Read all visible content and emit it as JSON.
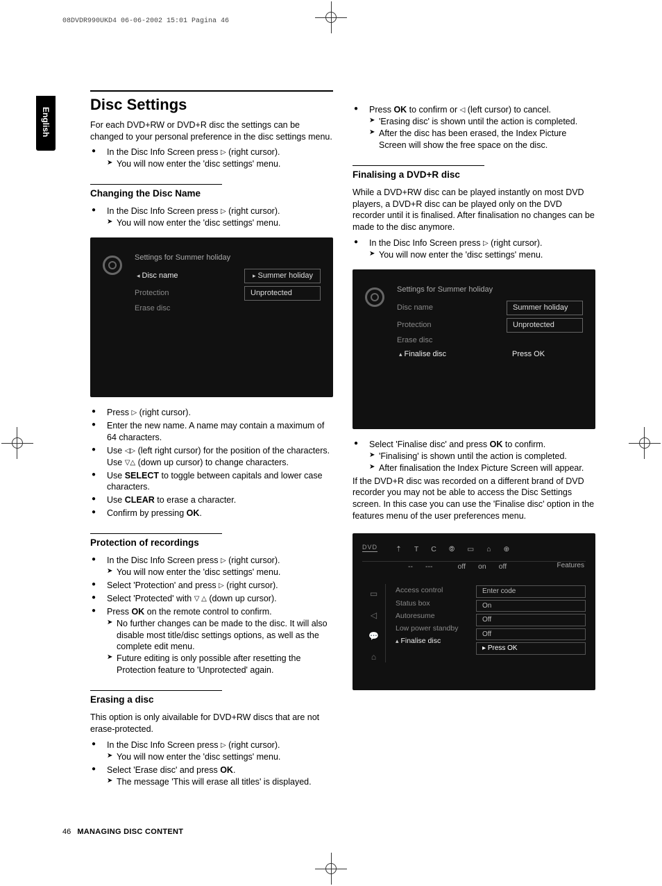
{
  "prepress": {
    "jobline": "08DVDR990UKD4  06-06-2002  15:01  Pagina 46"
  },
  "langtab": "English",
  "footer": {
    "page": "46",
    "chapter": "MANAGING DISC CONTENT"
  },
  "left": {
    "heading": "Disc Settings",
    "intro": "For each DVD+RW or DVD+R disc the settings can be changed to your personal preference in the disc settings menu.",
    "intro_b1_a": "In the Disc Info Screen press ",
    "intro_b1_b": " (right cursor).",
    "intro_b1_sub": "You will now enter the 'disc settings' menu.",
    "sub1": "Changing the Disc Name",
    "sub1_b1_a": "In the Disc Info Screen press ",
    "sub1_b1_b": " (right cursor).",
    "sub1_b1_sub": "You will now enter the 'disc settings' menu.",
    "osd1": {
      "title": "Settings for Summer holiday",
      "r1_label": "Disc name",
      "r1_value": "Summer holiday",
      "r2_label": "Protection",
      "r2_value": "Unprotected",
      "r3_label": "Erase disc"
    },
    "sub1_b2_a": "Press ",
    "sub1_b2_b": "  (right cursor).",
    "sub1_b3": "Enter the new name.  A name may contain a maximum of 64 characters.",
    "sub1_b4_a": "Use ",
    "sub1_b4_b": " (left right cursor) for the position of the characters. Use ",
    "sub1_b4_c": " (down up cursor) to change characters.",
    "sub1_b5_a": "Use ",
    "sub1_b5_bold": "SELECT",
    "sub1_b5_b": " to toggle between capitals and lower case characters.",
    "sub1_b6_a": "Use ",
    "sub1_b6_bold": "CLEAR",
    "sub1_b6_b": " to erase a character.",
    "sub1_b7_a": "Confirm by pressing ",
    "sub1_b7_bold": "OK",
    "sub1_b7_b": ".",
    "sub2": "Protection of recordings",
    "sub2_b1_a": "In the Disc Info Screen press ",
    "sub2_b1_b": " (right cursor).",
    "sub2_b1_sub": "You will now enter the 'disc settings' menu.",
    "sub2_b2_a": "Select '",
    "sub2_b2_ui": "Protection",
    "sub2_b2_b": "' and press ",
    "sub2_b2_c": " (right cursor).",
    "sub2_b3_a": "Select '",
    "sub2_b3_ui": "Protected",
    "sub2_b3_b": "' with ",
    "sub2_b3_c": " (down up cursor).",
    "sub2_b4_a": "Press ",
    "sub2_b4_bold": "OK",
    "sub2_b4_b": " on the remote control to confirm.",
    "sub2_b4_sub1": "No further changes can be made to the disc. It will also disable most title/disc settings options, as well as the complete edit menu.",
    "sub2_b4_sub2_a": "Future editing is only possible after resetting the Protection feature to '",
    "sub2_b4_sub2_ui": "Unprotected",
    "sub2_b4_sub2_b": "' again.",
    "sub3": "Erasing a disc",
    "sub3_intro": "This option is only aivailable for DVD+RW discs that are not erase-protected.",
    "sub3_b1_a": "In the Disc Info Screen press ",
    "sub3_b1_b": " (right cursor).",
    "sub3_b1_sub": "You will now enter the 'disc settings' menu.",
    "sub3_b2_a": "Select '",
    "sub3_b2_ui": "Erase disc",
    "sub3_b2_b": "' and press ",
    "sub3_b2_bold": "OK",
    "sub3_b2_c": ".",
    "sub3_b2_sub_a": "The message '",
    "sub3_b2_sub_ui": "This will erase all titles",
    "sub3_b2_sub_b": "' is displayed."
  },
  "right": {
    "top_b1_a": "Press ",
    "top_b1_bold": "OK",
    "top_b1_b": " to confirm or ",
    "top_b1_c": " (left cursor) to cancel.",
    "top_b1_sub1_a": "'",
    "top_b1_sub1_ui": "Erasing disc",
    "top_b1_sub1_b": "' is shown until the action is completed.",
    "top_b1_sub2": "After the disc has been erased, the Index Picture Screen will show the free space on the disc.",
    "sub1": "Finalising a DVD+R disc",
    "sub1_intro": "While a DVD+RW disc can be played instantly on most DVD players, a DVD+R disc can be played only on the DVD recorder until it is finalised.  After finalisation no changes can be made to the disc anymore.",
    "sub1_b1_a": "In the Disc Info Screen press ",
    "sub1_b1_b": " (right cursor).",
    "sub1_b1_sub": "You will now enter the 'disc settings' menu.",
    "osd2": {
      "title": "Settings for Summer holiday",
      "r1_label": "Disc name",
      "r1_value": "Summer holiday",
      "r2_label": "Protection",
      "r2_value": "Unprotected",
      "r3_label": "Erase disc",
      "r4_label": "Finalise disc",
      "r4_value": "Press OK"
    },
    "sub1_b2_a": "Select '",
    "sub1_b2_ui": "Finalise disc",
    "sub1_b2_b": "' and press ",
    "sub1_b2_bold": "OK",
    "sub1_b2_c": " to confirm.",
    "sub1_b2_sub1_a": "'",
    "sub1_b2_sub1_ui": "Finalising",
    "sub1_b2_sub1_b": "' is shown until the action is completed.",
    "sub1_b2_sub2": "After finalisation the Index Picture Screen will appear.",
    "sub1_tail_a": "If the DVD+R disc was recorded on a different brand of DVD recorder you may not be able to access the Disc Settings screen. In this case you can use the '",
    "sub1_tail_ui": "Finalise disc",
    "sub1_tail_b": "' option in the features menu of the user preferences menu.",
    "osd3": {
      "logo": "DVD",
      "top_labels": [
        "⇡",
        "T",
        "C",
        "⦾",
        "▭",
        "⌂",
        "⊕"
      ],
      "top_vals": [
        "",
        "--",
        "---",
        "",
        "off",
        "on",
        "off"
      ],
      "corner": "Features",
      "left_items": [
        "Access control",
        "Status box",
        "Autoresume",
        "Low power standby",
        "Finalise disc"
      ],
      "right_items": [
        "Enter code",
        "On",
        "Off",
        "Off",
        "Press OK"
      ]
    }
  }
}
